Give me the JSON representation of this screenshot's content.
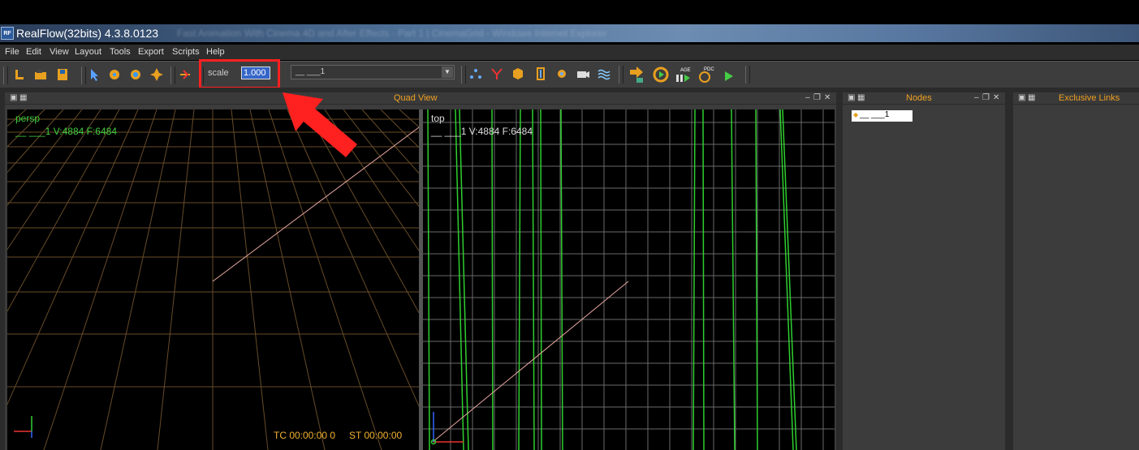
{
  "window": {
    "title": "RealFlow(32bits) 4.3.8.0123",
    "blurred_title": "Fast Animation With Cinema 4D and After Effects - Part 1 | CinemaGrid - Windows Internet Explorer"
  },
  "menu": {
    "items": [
      "File",
      "Edit",
      "View",
      "Layout",
      "Tools",
      "Export",
      "Scripts",
      "Help"
    ]
  },
  "toolbar": {
    "scale_label": "scale",
    "scale_value": "1.000",
    "combo_value": "__ ___1",
    "icons": [
      "new-scene-icon",
      "open-scene-icon",
      "save-scene-icon",
      "select-icon",
      "move-icon",
      "rotate-icon",
      "scale-icon",
      "link-icon",
      "emitter-icon",
      "daemon-icon",
      "object-icon",
      "constraint-icon",
      "import-icon",
      "camera-icon",
      "mesh-icon",
      "simulate-icon",
      "reset-icon",
      "age-icon",
      "pdc-icon",
      "play-icon"
    ],
    "highlight_color": "#ff2020"
  },
  "panels": {
    "quad_view": {
      "title": "Quad View"
    },
    "nodes": {
      "title": "Nodes",
      "items": [
        "__ ___1"
      ]
    },
    "exclusive_links": {
      "title": "Exclusive Links"
    }
  },
  "viewports": {
    "persp": {
      "label": "persp",
      "info": "__ ___1 V:4884 F:6484",
      "label_color": "#3fcf3f",
      "tc": "TC 00:00:00 0",
      "st": "ST 00:00:00"
    },
    "top": {
      "label": "top",
      "info": "__ ___1 V:4884 F:6484",
      "label_color": "#dddddd"
    }
  }
}
